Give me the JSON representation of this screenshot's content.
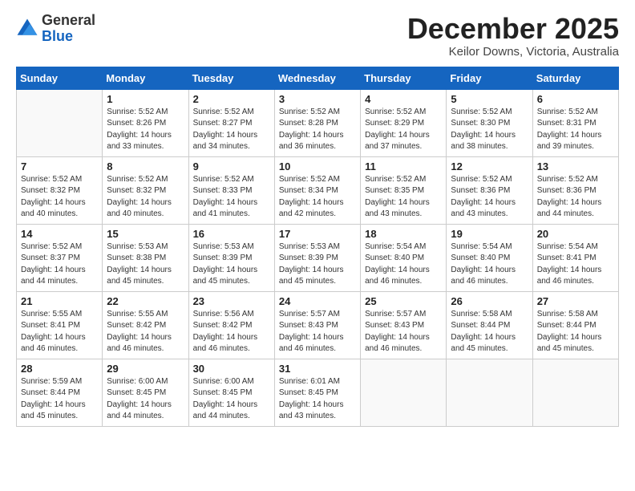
{
  "logo": {
    "general": "General",
    "blue": "Blue"
  },
  "header": {
    "title": "December 2025",
    "subtitle": "Keilor Downs, Victoria, Australia"
  },
  "weekdays": [
    "Sunday",
    "Monday",
    "Tuesday",
    "Wednesday",
    "Thursday",
    "Friday",
    "Saturday"
  ],
  "weeks": [
    [
      {
        "day": "",
        "detail": ""
      },
      {
        "day": "1",
        "detail": "Sunrise: 5:52 AM\nSunset: 8:26 PM\nDaylight: 14 hours\nand 33 minutes."
      },
      {
        "day": "2",
        "detail": "Sunrise: 5:52 AM\nSunset: 8:27 PM\nDaylight: 14 hours\nand 34 minutes."
      },
      {
        "day": "3",
        "detail": "Sunrise: 5:52 AM\nSunset: 8:28 PM\nDaylight: 14 hours\nand 36 minutes."
      },
      {
        "day": "4",
        "detail": "Sunrise: 5:52 AM\nSunset: 8:29 PM\nDaylight: 14 hours\nand 37 minutes."
      },
      {
        "day": "5",
        "detail": "Sunrise: 5:52 AM\nSunset: 8:30 PM\nDaylight: 14 hours\nand 38 minutes."
      },
      {
        "day": "6",
        "detail": "Sunrise: 5:52 AM\nSunset: 8:31 PM\nDaylight: 14 hours\nand 39 minutes."
      }
    ],
    [
      {
        "day": "7",
        "detail": "Sunrise: 5:52 AM\nSunset: 8:32 PM\nDaylight: 14 hours\nand 40 minutes."
      },
      {
        "day": "8",
        "detail": "Sunrise: 5:52 AM\nSunset: 8:32 PM\nDaylight: 14 hours\nand 40 minutes."
      },
      {
        "day": "9",
        "detail": "Sunrise: 5:52 AM\nSunset: 8:33 PM\nDaylight: 14 hours\nand 41 minutes."
      },
      {
        "day": "10",
        "detail": "Sunrise: 5:52 AM\nSunset: 8:34 PM\nDaylight: 14 hours\nand 42 minutes."
      },
      {
        "day": "11",
        "detail": "Sunrise: 5:52 AM\nSunset: 8:35 PM\nDaylight: 14 hours\nand 43 minutes."
      },
      {
        "day": "12",
        "detail": "Sunrise: 5:52 AM\nSunset: 8:36 PM\nDaylight: 14 hours\nand 43 minutes."
      },
      {
        "day": "13",
        "detail": "Sunrise: 5:52 AM\nSunset: 8:36 PM\nDaylight: 14 hours\nand 44 minutes."
      }
    ],
    [
      {
        "day": "14",
        "detail": "Sunrise: 5:52 AM\nSunset: 8:37 PM\nDaylight: 14 hours\nand 44 minutes."
      },
      {
        "day": "15",
        "detail": "Sunrise: 5:53 AM\nSunset: 8:38 PM\nDaylight: 14 hours\nand 45 minutes."
      },
      {
        "day": "16",
        "detail": "Sunrise: 5:53 AM\nSunset: 8:39 PM\nDaylight: 14 hours\nand 45 minutes."
      },
      {
        "day": "17",
        "detail": "Sunrise: 5:53 AM\nSunset: 8:39 PM\nDaylight: 14 hours\nand 45 minutes."
      },
      {
        "day": "18",
        "detail": "Sunrise: 5:54 AM\nSunset: 8:40 PM\nDaylight: 14 hours\nand 46 minutes."
      },
      {
        "day": "19",
        "detail": "Sunrise: 5:54 AM\nSunset: 8:40 PM\nDaylight: 14 hours\nand 46 minutes."
      },
      {
        "day": "20",
        "detail": "Sunrise: 5:54 AM\nSunset: 8:41 PM\nDaylight: 14 hours\nand 46 minutes."
      }
    ],
    [
      {
        "day": "21",
        "detail": "Sunrise: 5:55 AM\nSunset: 8:41 PM\nDaylight: 14 hours\nand 46 minutes."
      },
      {
        "day": "22",
        "detail": "Sunrise: 5:55 AM\nSunset: 8:42 PM\nDaylight: 14 hours\nand 46 minutes."
      },
      {
        "day": "23",
        "detail": "Sunrise: 5:56 AM\nSunset: 8:42 PM\nDaylight: 14 hours\nand 46 minutes."
      },
      {
        "day": "24",
        "detail": "Sunrise: 5:57 AM\nSunset: 8:43 PM\nDaylight: 14 hours\nand 46 minutes."
      },
      {
        "day": "25",
        "detail": "Sunrise: 5:57 AM\nSunset: 8:43 PM\nDaylight: 14 hours\nand 46 minutes."
      },
      {
        "day": "26",
        "detail": "Sunrise: 5:58 AM\nSunset: 8:44 PM\nDaylight: 14 hours\nand 45 minutes."
      },
      {
        "day": "27",
        "detail": "Sunrise: 5:58 AM\nSunset: 8:44 PM\nDaylight: 14 hours\nand 45 minutes."
      }
    ],
    [
      {
        "day": "28",
        "detail": "Sunrise: 5:59 AM\nSunset: 8:44 PM\nDaylight: 14 hours\nand 45 minutes."
      },
      {
        "day": "29",
        "detail": "Sunrise: 6:00 AM\nSunset: 8:45 PM\nDaylight: 14 hours\nand 44 minutes."
      },
      {
        "day": "30",
        "detail": "Sunrise: 6:00 AM\nSunset: 8:45 PM\nDaylight: 14 hours\nand 44 minutes."
      },
      {
        "day": "31",
        "detail": "Sunrise: 6:01 AM\nSunset: 8:45 PM\nDaylight: 14 hours\nand 43 minutes."
      },
      {
        "day": "",
        "detail": ""
      },
      {
        "day": "",
        "detail": ""
      },
      {
        "day": "",
        "detail": ""
      }
    ]
  ]
}
